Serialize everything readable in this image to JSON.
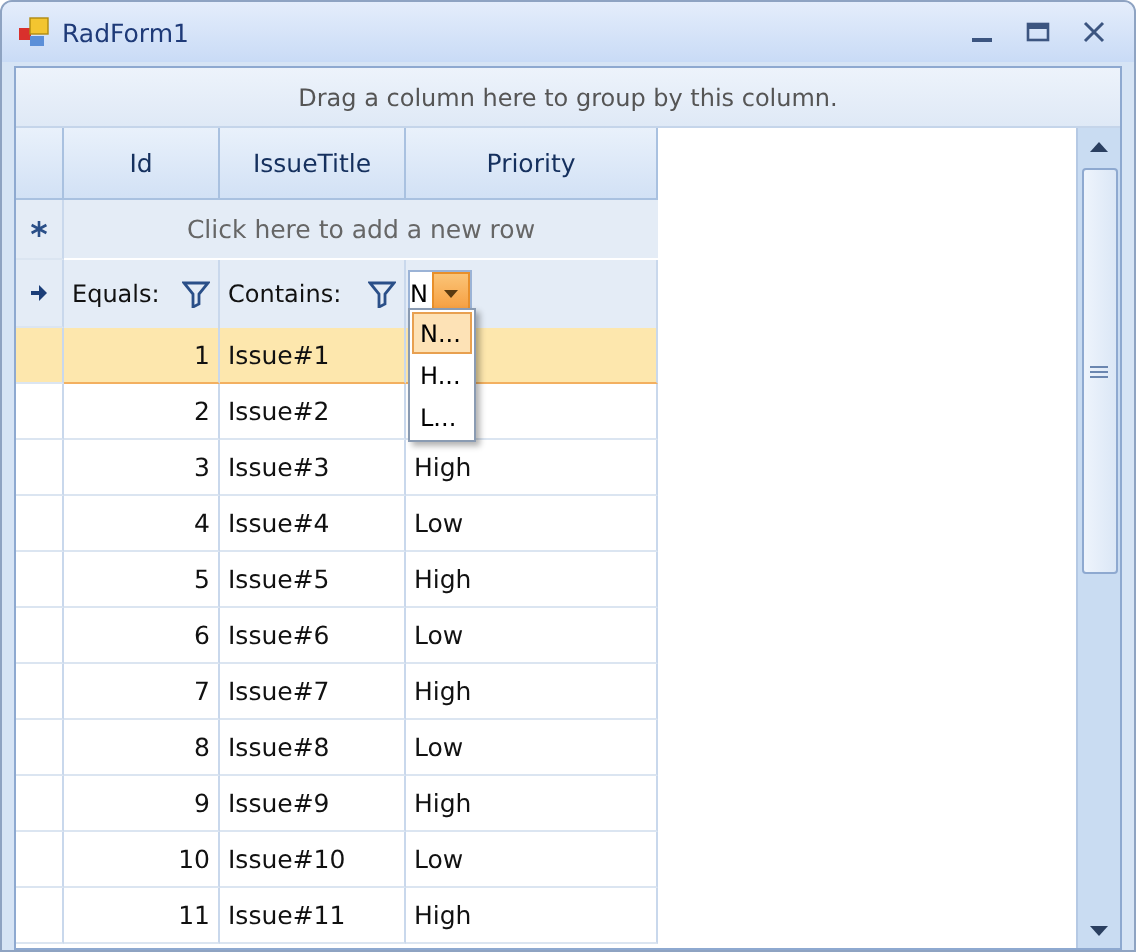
{
  "window": {
    "title": "RadForm1"
  },
  "group_panel": {
    "text": "Drag a column here to group by this column."
  },
  "columns": [
    "Id",
    "IssueTitle",
    "Priority"
  ],
  "new_row": {
    "text": "Click here to add a new row"
  },
  "filter_row": {
    "cells": [
      {
        "kind": "operator",
        "label": "Equals:"
      },
      {
        "kind": "operator",
        "label": "Contains:"
      },
      {
        "kind": "dropdown",
        "value": "N"
      }
    ]
  },
  "filter_dropdown": {
    "options": [
      {
        "label": "N...",
        "selected": true
      },
      {
        "label": "H...",
        "selected": false
      },
      {
        "label": "L...",
        "selected": false
      }
    ]
  },
  "rows": [
    {
      "id": "1",
      "title": "Issue#1",
      "selected": true
    },
    {
      "id": "2",
      "title": "Issue#2",
      "selected": false
    },
    {
      "id": "3",
      "title": "Issue#3",
      "priority": "High",
      "selected": false
    },
    {
      "id": "4",
      "title": "Issue#4",
      "priority": "Low",
      "selected": false
    },
    {
      "id": "5",
      "title": "Issue#5",
      "priority": "High",
      "selected": false
    },
    {
      "id": "6",
      "title": "Issue#6",
      "priority": "Low",
      "selected": false
    },
    {
      "id": "7",
      "title": "Issue#7",
      "priority": "High",
      "selected": false
    },
    {
      "id": "8",
      "title": "Issue#8",
      "priority": "Low",
      "selected": false
    },
    {
      "id": "9",
      "title": "Issue#9",
      "priority": "High",
      "selected": false
    },
    {
      "id": "10",
      "title": "Issue#10",
      "priority": "Low",
      "selected": false
    },
    {
      "id": "11",
      "title": "Issue#11",
      "priority": "High",
      "selected": false
    }
  ]
}
